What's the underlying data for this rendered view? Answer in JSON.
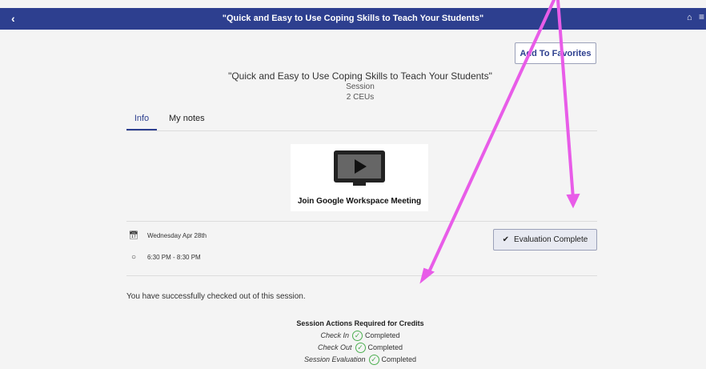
{
  "topbar": {
    "back_icon": "chevron-left-icon",
    "title": "\"Quick and Easy to Use Coping Skills to Teach Your Students\"",
    "home_icon": "home-icon",
    "menu_icon": "menu-icon"
  },
  "favorites": {
    "label": "Add To Favorites"
  },
  "session": {
    "title": "\"Quick and Easy to Use Coping Skills to Teach Your Students\"",
    "type": "Session",
    "ceus": "2 CEUs"
  },
  "tabs": [
    {
      "label": "Info",
      "active": true
    },
    {
      "label": "My notes",
      "active": false
    }
  ],
  "meeting": {
    "label": "Join Google Workspace Meeting",
    "icon": "play-monitor-icon"
  },
  "schedule": {
    "date": "Wednesday Apr 28th",
    "time": "6:30 PM - 8:30 PM"
  },
  "evaluation": {
    "label": "Evaluation Complete"
  },
  "checkout_message": "You have successfully checked out of this session.",
  "actions": {
    "heading": "Session Actions Required for Credits",
    "items": [
      {
        "name": "Check In",
        "status": "Completed"
      },
      {
        "name": "Check Out",
        "status": "Completed"
      },
      {
        "name": "Session Evaluation",
        "status": "Completed"
      }
    ]
  },
  "colors": {
    "brand": "#2d3f8f",
    "annotation": "#e85ce8",
    "success": "#4caf50"
  }
}
